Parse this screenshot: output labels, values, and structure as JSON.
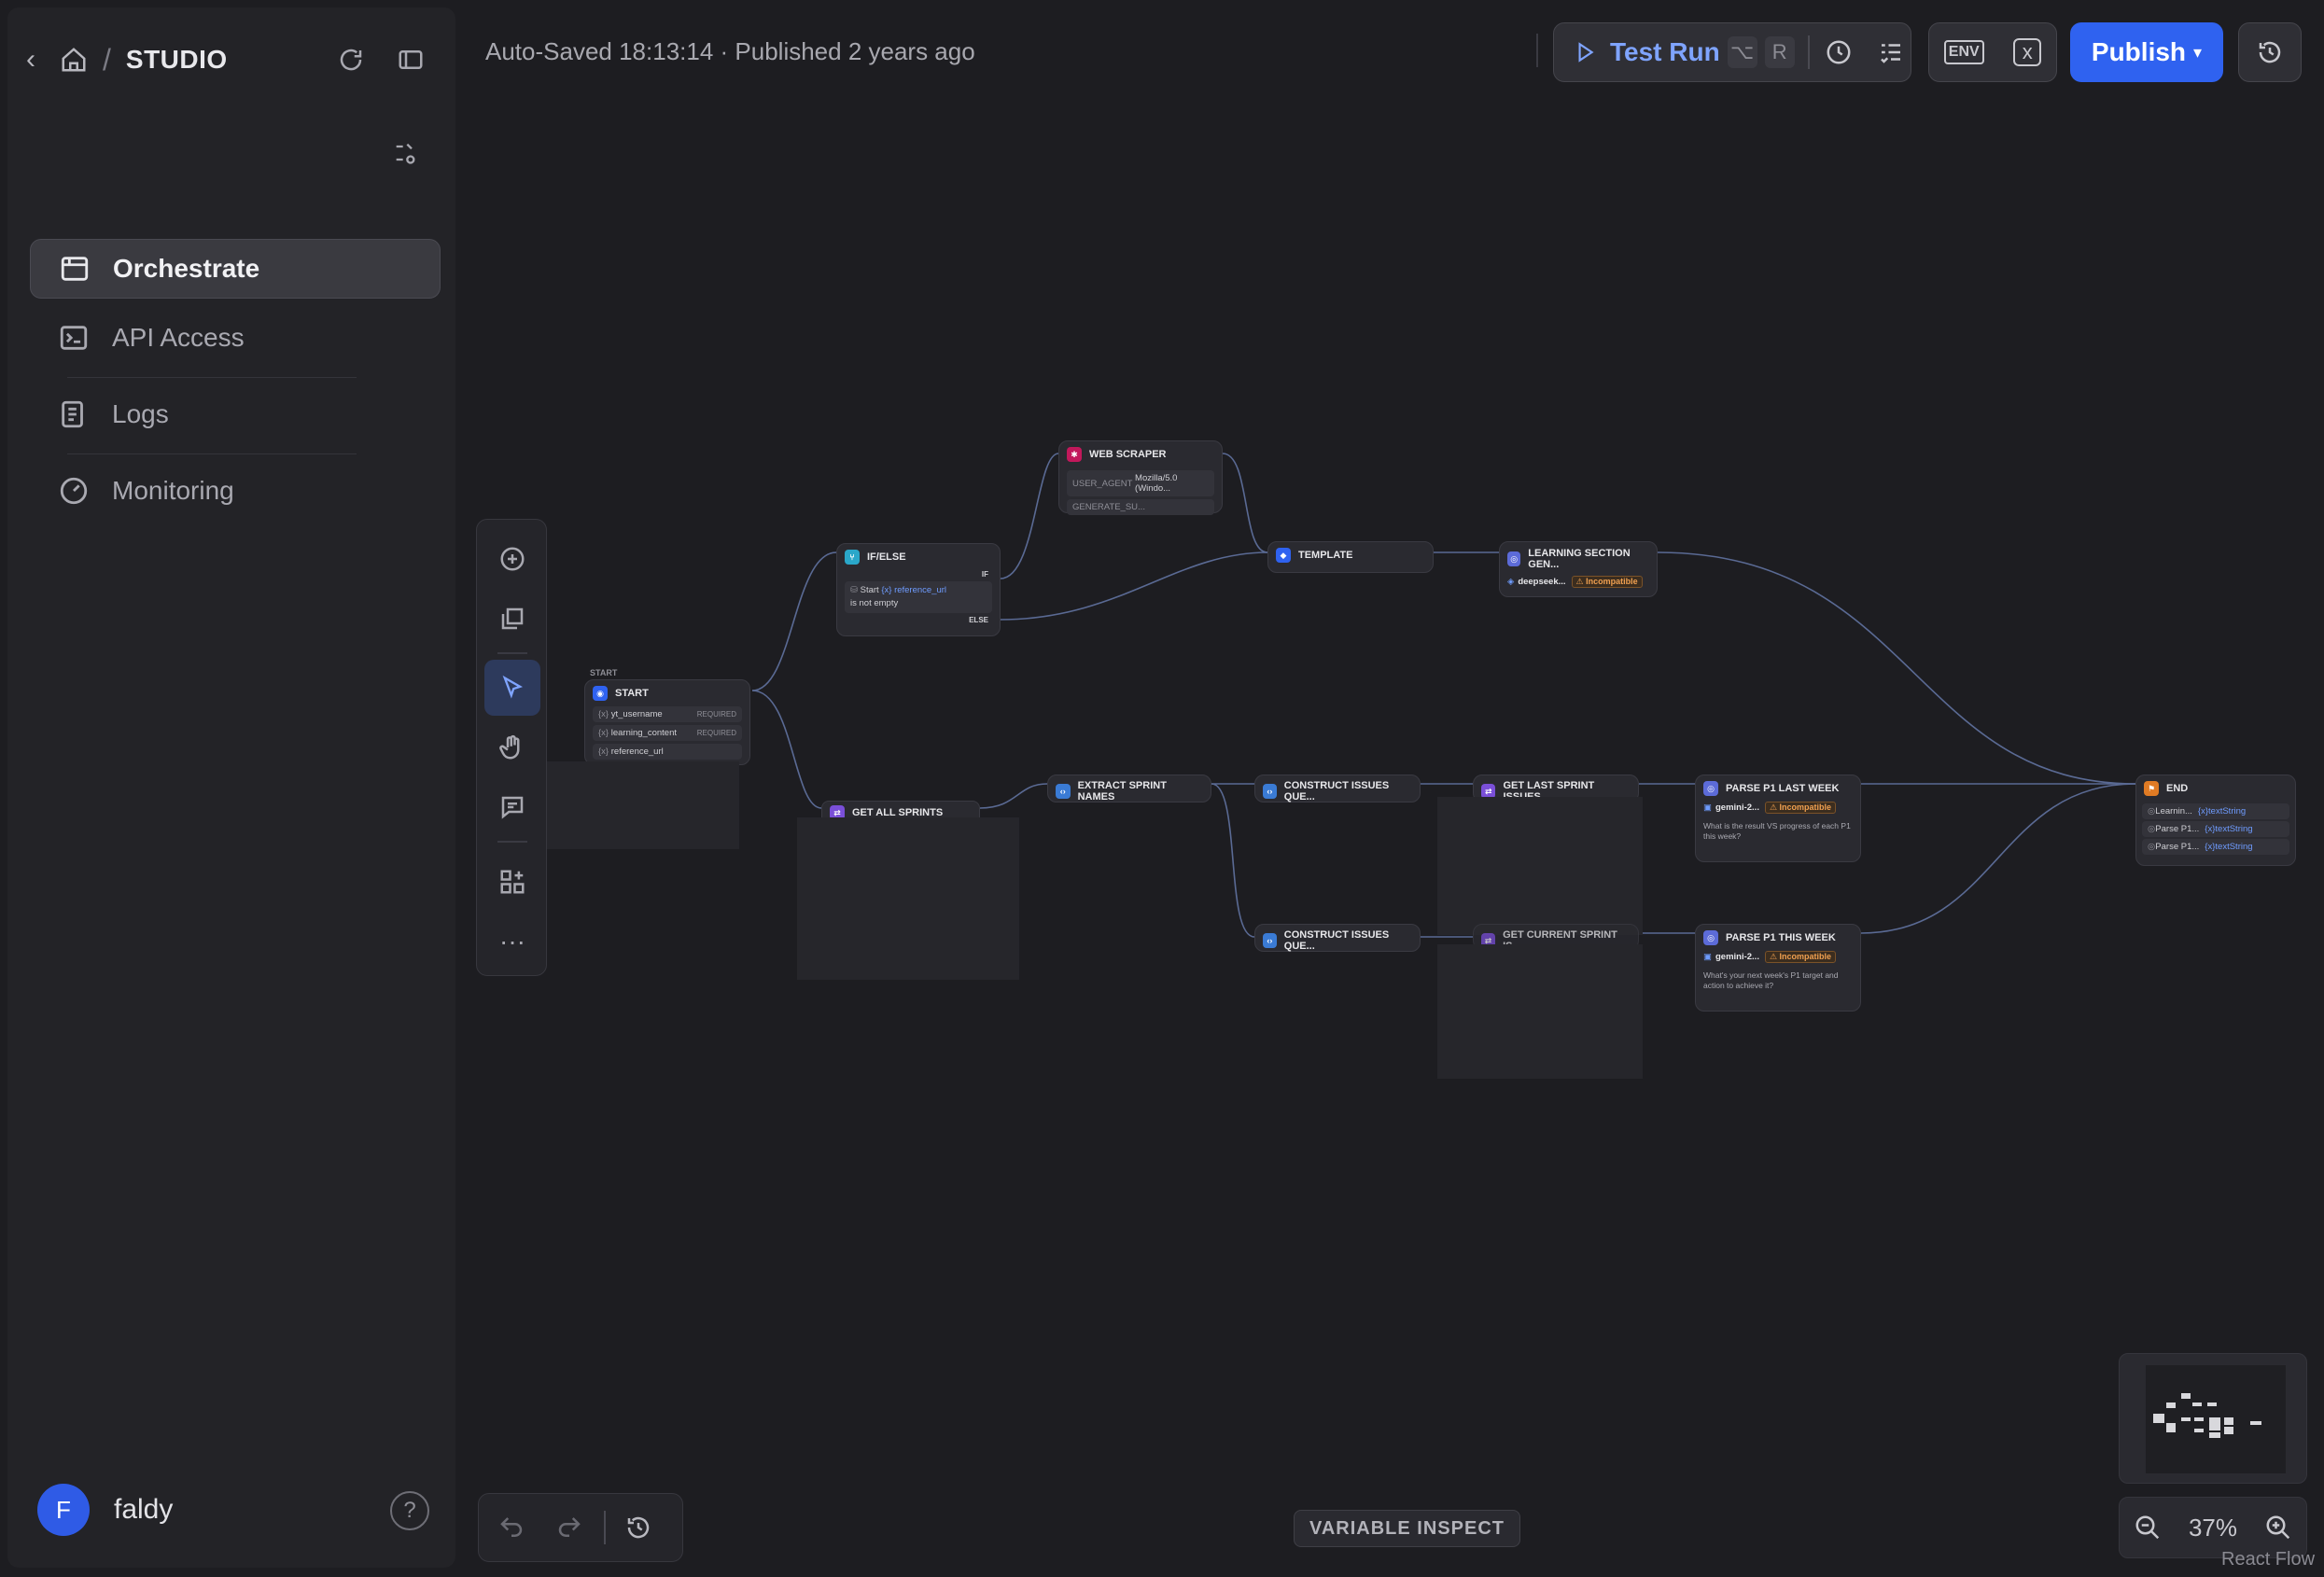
{
  "app": {
    "breadcrumb_title": "STUDIO"
  },
  "sidebar": {
    "items": [
      {
        "label": "Orchestrate",
        "icon": "window-icon",
        "active": true
      },
      {
        "label": "API Access",
        "icon": "terminal-icon",
        "active": false
      },
      {
        "label": "Logs",
        "icon": "document-icon",
        "active": false
      },
      {
        "label": "Monitoring",
        "icon": "gauge-icon",
        "active": false
      }
    ],
    "user": {
      "initial": "F",
      "name": "faldy"
    }
  },
  "header": {
    "status": "Auto-Saved 18:13:14 · Published 2 years ago",
    "test_run_label": "Test Run",
    "test_run_keys": [
      "⌥",
      "R"
    ],
    "env_label": "ENV",
    "publish_label": "Publish"
  },
  "nodes": {
    "start": {
      "caption": "START",
      "title": "START",
      "vars": [
        {
          "name": "yt_username",
          "tag": "REQUIRED"
        },
        {
          "name": "learning_content",
          "tag": "REQUIRED"
        },
        {
          "name": "reference_url",
          "tag": ""
        }
      ]
    },
    "ifelse": {
      "title": "IF/ELSE",
      "if": "IF",
      "cond_src": "Start",
      "cond_var": "reference_url",
      "cond_op": "is not empty",
      "else": "ELSE"
    },
    "webscraper": {
      "title": "WEB SCRAPER",
      "row1_key": "USER_AGENT",
      "row1_val": "Mozilla/5.0 (Windo...",
      "row2_key": "GENERATE_SU..."
    },
    "template": {
      "title": "TEMPLATE"
    },
    "learning": {
      "title": "LEARNING SECTION GEN...",
      "model": "deepseek...",
      "badge": "Incompatible"
    },
    "getallsprints": {
      "title": "GET ALL SPRINTS"
    },
    "extract": {
      "title": "EXTRACT SPRINT NAMES"
    },
    "construct1": {
      "title": "CONSTRUCT ISSUES QUE..."
    },
    "construct2": {
      "title": "CONSTRUCT ISSUES QUE..."
    },
    "getlast": {
      "title": "GET LAST SPRINT ISSUES"
    },
    "getcurrent": {
      "title": "GET CURRENT SPRINT IS..."
    },
    "parselast": {
      "title": "PARSE P1 LAST WEEK",
      "model": "gemini-2...",
      "badge": "Incompatible",
      "prompt": "What is the result VS progress of each P1 this week?"
    },
    "parsethis": {
      "title": "PARSE P1 THIS WEEK",
      "model": "gemini-2...",
      "badge": "Incompatible",
      "prompt": "What's your next week's P1 target and action to achieve it?"
    },
    "end": {
      "title": "END",
      "outputs": [
        {
          "name": "Learnin...",
          "type": "textString"
        },
        {
          "name": "Parse P1...",
          "type": "textString"
        },
        {
          "name": "Parse P1...",
          "type": "textString"
        }
      ]
    }
  },
  "bottom": {
    "variable_inspect": "VARIABLE INSPECT",
    "zoom": "37%",
    "attribution": "React Flow"
  },
  "colors": {
    "accent": "#2f62f0",
    "link": "#7fa4ff",
    "warning": "#f0a050"
  }
}
